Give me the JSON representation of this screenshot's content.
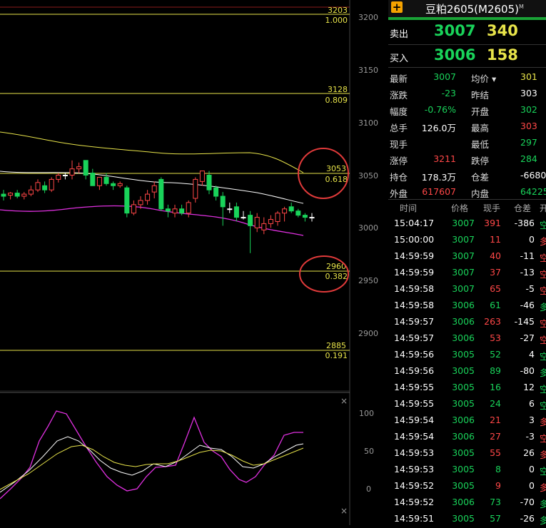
{
  "chart": {
    "y_axis": [
      "3200",
      "3150",
      "3100",
      "3050",
      "3000",
      "2950",
      "2900"
    ],
    "fib_levels": [
      {
        "price": "3203",
        "ratio": "1.000"
      },
      {
        "price": "3128",
        "ratio": "0.809"
      },
      {
        "price": "3053",
        "ratio": "0.618"
      },
      {
        "price": "2960",
        "ratio": "0.382"
      },
      {
        "price": "2885",
        "ratio": "0.191"
      }
    ],
    "osc_axis": [
      "100",
      "50",
      "0"
    ],
    "close_label": "×"
  },
  "header": {
    "plus": "+",
    "title": "豆粕2605(M2605)",
    "superscript": "M"
  },
  "order_book": {
    "ask_label": "卖出",
    "ask_price": "3007",
    "ask_volume": "340",
    "bid_label": "买入",
    "bid_price": "3006",
    "bid_volume": "158"
  },
  "quote": [
    {
      "l1": "最新",
      "v1": "3007",
      "c1": "green",
      "l2": "均价 ▾",
      "v2": "301",
      "c2": "yellow"
    },
    {
      "l1": "涨跌",
      "v1": "-23",
      "c1": "green",
      "l2": "昨结",
      "v2": "303",
      "c2": "white"
    },
    {
      "l1": "幅度",
      "v1": "-0.76%",
      "c1": "green",
      "l2": "开盘",
      "v2": "302",
      "c2": "green"
    },
    {
      "l1": "总手",
      "v1": "126.0万",
      "c1": "white",
      "l2": "最高",
      "v2": "303",
      "c2": "red"
    },
    {
      "l1": "现手",
      "v1": "",
      "c1": "white",
      "l2": "最低",
      "v2": "297",
      "c2": "green"
    },
    {
      "l1": "涨停",
      "v1": "3211",
      "c1": "red",
      "l2": "跌停",
      "v2": "284",
      "c2": "green"
    },
    {
      "l1": "持仓",
      "v1": "178.3万",
      "c1": "white",
      "l2": "仓差",
      "v2": "-6680",
      "c2": "white"
    },
    {
      "l1": "外盘",
      "v1": "617607",
      "c1": "red",
      "l2": "内盘",
      "v2": "64225",
      "c2": "green"
    }
  ],
  "ticks_header": [
    "时间",
    "价格",
    "现手",
    "仓差",
    "开"
  ],
  "ticks": [
    {
      "time": "15:04:17",
      "price": "3007",
      "vol": "391",
      "vc": "red",
      "oi": "-386",
      "type": "空",
      "tc": "green"
    },
    {
      "time": "15:00:00",
      "price": "3007",
      "vol": "11",
      "vc": "red",
      "oi": "0",
      "type": "多",
      "tc": "red"
    },
    {
      "time": "14:59:59",
      "price": "3007",
      "vol": "40",
      "vc": "red",
      "oi": "-11",
      "type": "空",
      "tc": "red"
    },
    {
      "time": "14:59:59",
      "price": "3007",
      "vol": "37",
      "vc": "red",
      "oi": "-13",
      "type": "空",
      "tc": "red"
    },
    {
      "time": "14:59:58",
      "price": "3007",
      "vol": "65",
      "vc": "red",
      "oi": "-5",
      "type": "空",
      "tc": "red"
    },
    {
      "time": "14:59:58",
      "price": "3006",
      "vol": "61",
      "vc": "green",
      "oi": "-46",
      "type": "多",
      "tc": "green"
    },
    {
      "time": "14:59:57",
      "price": "3006",
      "vol": "263",
      "vc": "red",
      "oi": "-145",
      "type": "空",
      "tc": "red"
    },
    {
      "time": "14:59:57",
      "price": "3006",
      "vol": "53",
      "vc": "red",
      "oi": "-27",
      "type": "空",
      "tc": "red"
    },
    {
      "time": "14:59:56",
      "price": "3005",
      "vol": "52",
      "vc": "green",
      "oi": "4",
      "type": "空",
      "tc": "green"
    },
    {
      "time": "14:59:56",
      "price": "3005",
      "vol": "89",
      "vc": "green",
      "oi": "-80",
      "type": "多",
      "tc": "green"
    },
    {
      "time": "14:59:55",
      "price": "3005",
      "vol": "16",
      "vc": "green",
      "oi": "12",
      "type": "空",
      "tc": "green"
    },
    {
      "time": "14:59:55",
      "price": "3005",
      "vol": "24",
      "vc": "green",
      "oi": "6",
      "type": "空",
      "tc": "green"
    },
    {
      "time": "14:59:54",
      "price": "3006",
      "vol": "21",
      "vc": "red",
      "oi": "3",
      "type": "多",
      "tc": "red"
    },
    {
      "time": "14:59:54",
      "price": "3006",
      "vol": "27",
      "vc": "red",
      "oi": "-3",
      "type": "空",
      "tc": "red"
    },
    {
      "time": "14:59:53",
      "price": "3005",
      "vol": "55",
      "vc": "red",
      "oi": "26",
      "type": "多",
      "tc": "red"
    },
    {
      "time": "14:59:53",
      "price": "3005",
      "vol": "8",
      "vc": "green",
      "oi": "0",
      "type": "空",
      "tc": "green"
    },
    {
      "time": "14:59:52",
      "price": "3005",
      "vol": "9",
      "vc": "red",
      "oi": "0",
      "type": "多",
      "tc": "red"
    },
    {
      "time": "14:59:52",
      "price": "3006",
      "vol": "73",
      "vc": "green",
      "oi": "-70",
      "type": "多",
      "tc": "green"
    },
    {
      "time": "14:59:51",
      "price": "3005",
      "vol": "57",
      "vc": "green",
      "oi": "-26",
      "type": "多",
      "tc": "green"
    }
  ],
  "colors": {
    "up": "#ff4747",
    "down": "#19d35a",
    "fib": "#e8e44a",
    "accent": "#1aa336",
    "annotation": "#e03a3a"
  }
}
